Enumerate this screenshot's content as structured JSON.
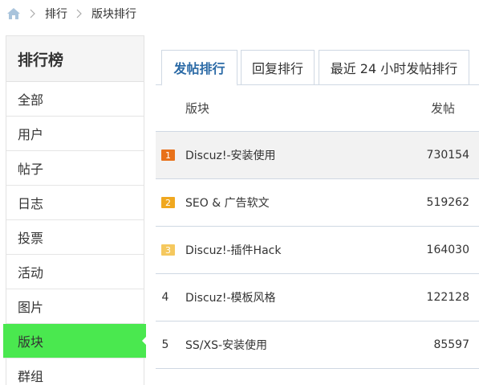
{
  "breadcrumb": {
    "home_icon": "home-icon",
    "items": [
      "排行",
      "版块排行"
    ]
  },
  "sidebar": {
    "title": "排行榜",
    "items": [
      {
        "label": "全部"
      },
      {
        "label": "用户"
      },
      {
        "label": "帖子"
      },
      {
        "label": "日志"
      },
      {
        "label": "投票"
      },
      {
        "label": "活动"
      },
      {
        "label": "图片"
      },
      {
        "label": "版块",
        "active": true
      },
      {
        "label": "群组"
      }
    ],
    "active_color": "#4ae84f"
  },
  "tabs": [
    {
      "label": "发帖排行",
      "active": true
    },
    {
      "label": "回复排行"
    },
    {
      "label": "最近 24 小时发帖排行"
    }
  ],
  "table": {
    "headers": {
      "name": "版块",
      "count": "发帖"
    },
    "rows": [
      {
        "rank": "1",
        "name": "Discuz!-安装使用",
        "count": "730154",
        "badge_color": "#e8711a"
      },
      {
        "rank": "2",
        "name": "SEO & 广告软文",
        "count": "519262",
        "badge_color": "#f0a820"
      },
      {
        "rank": "3",
        "name": "Discuz!-插件Hack",
        "count": "164030",
        "badge_color": "#f5c85e"
      },
      {
        "rank": "4",
        "name": "Discuz!-模板风格",
        "count": "122128"
      },
      {
        "rank": "5",
        "name": "SS/XS-安装使用",
        "count": "85597"
      }
    ]
  },
  "colors": {
    "tab_active_text": "#2b6aa6",
    "border": "#cfd8e3"
  }
}
